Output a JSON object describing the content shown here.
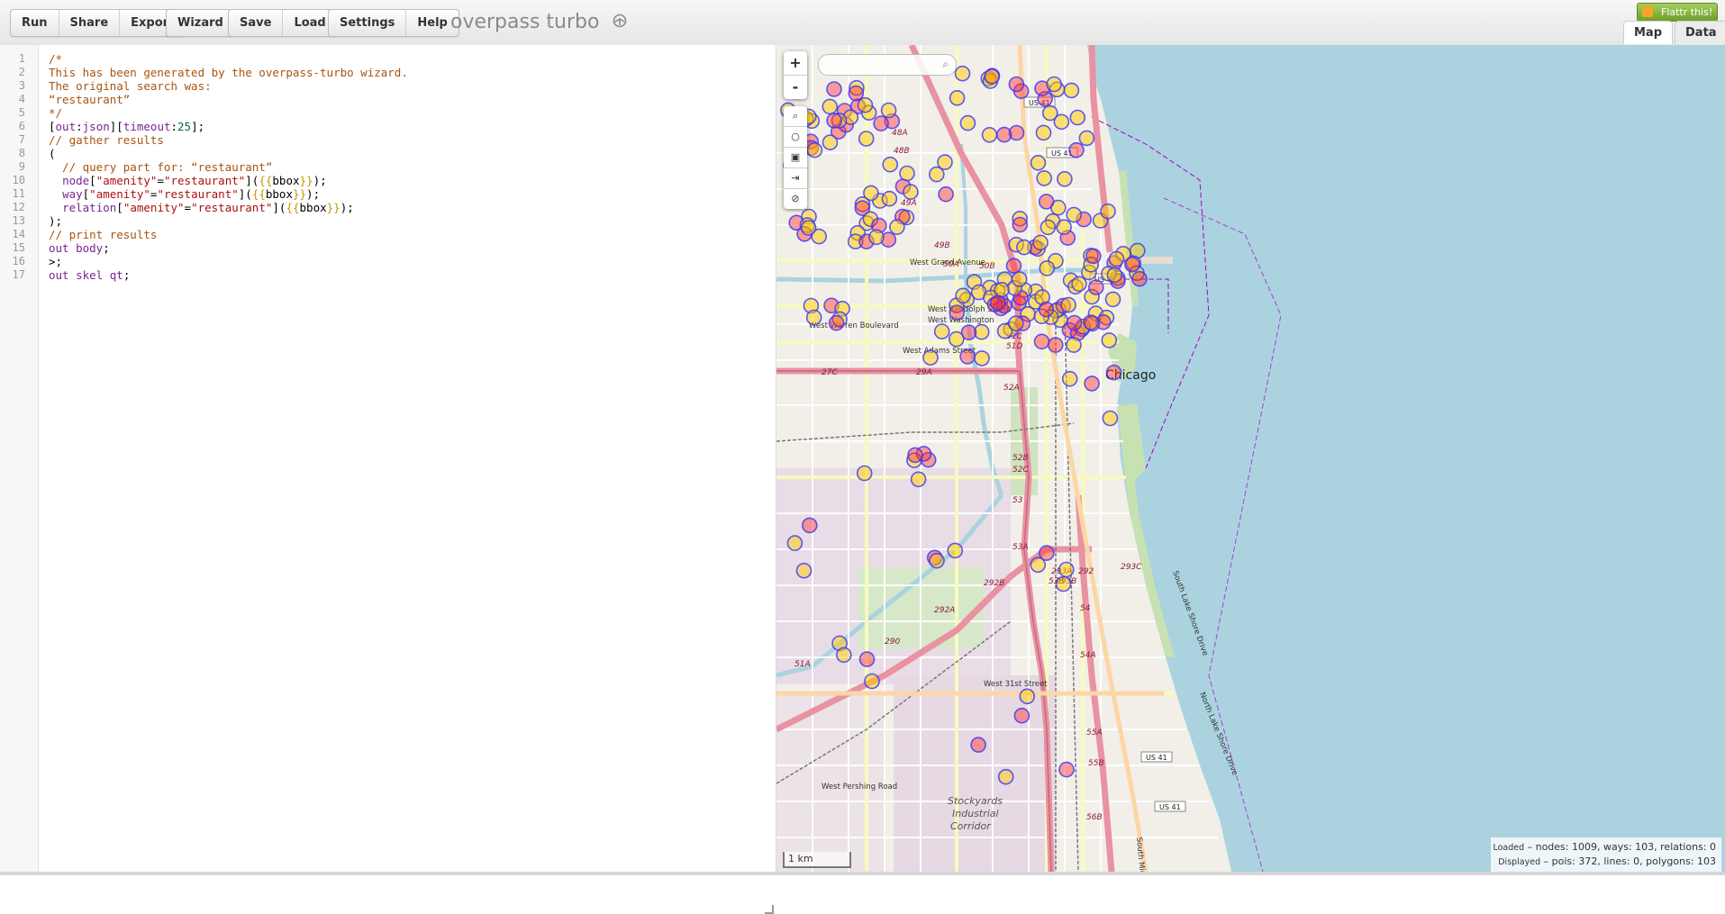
{
  "toolbar": {
    "groups": [
      [
        "Run",
        "Share",
        "Export"
      ],
      [
        "Wizard"
      ],
      [
        "Save",
        "Load"
      ],
      [
        "Settings",
        "Help"
      ]
    ],
    "app_title": "overpass turbo",
    "flattr_label": "Flattr this!",
    "view_tabs": [
      {
        "label": "Map",
        "active": true
      },
      {
        "label": "Data",
        "active": false
      }
    ]
  },
  "editor": {
    "line_numbers": [
      "1",
      "2",
      "3",
      "4",
      "5",
      "6",
      "7",
      "8",
      "9",
      "10",
      "11",
      "12",
      "13",
      "14",
      "15",
      "16",
      "17"
    ],
    "lines": [
      [
        {
          "t": "/*",
          "c": "cm"
        }
      ],
      [
        {
          "t": "This has been generated by the overpass-turbo wizard.",
          "c": "cm"
        }
      ],
      [
        {
          "t": "The original search was:",
          "c": "cm"
        }
      ],
      [
        {
          "t": "“restaurant”",
          "c": "cm"
        }
      ],
      [
        {
          "t": "*/",
          "c": "cm"
        }
      ],
      [
        {
          "t": "[",
          "c": "pl"
        },
        {
          "t": "out",
          "c": "kw"
        },
        {
          "t": ":",
          "c": "pl"
        },
        {
          "t": "json",
          "c": "kw"
        },
        {
          "t": "][",
          "c": "pl"
        },
        {
          "t": "timeout",
          "c": "kw"
        },
        {
          "t": ":",
          "c": "pl"
        },
        {
          "t": "25",
          "c": "num"
        },
        {
          "t": "];",
          "c": "pl"
        }
      ],
      [
        {
          "t": "// gather results",
          "c": "cm"
        }
      ],
      [
        {
          "t": "(",
          "c": "pl"
        }
      ],
      [
        {
          "t": "  // query part for: “restaurant”",
          "c": "cm"
        }
      ],
      [
        {
          "t": "  ",
          "c": "pl"
        },
        {
          "t": "node",
          "c": "kw"
        },
        {
          "t": "[",
          "c": "pl"
        },
        {
          "t": "\"amenity\"",
          "c": "str"
        },
        {
          "t": "=",
          "c": "pl"
        },
        {
          "t": "\"restaurant\"",
          "c": "str"
        },
        {
          "t": "](",
          "c": "pl"
        },
        {
          "t": "{{",
          "c": "br"
        },
        {
          "t": "bbox",
          "c": "pl"
        },
        {
          "t": "}}",
          "c": "br"
        },
        {
          "t": ");",
          "c": "pl"
        }
      ],
      [
        {
          "t": "  ",
          "c": "pl"
        },
        {
          "t": "way",
          "c": "kw"
        },
        {
          "t": "[",
          "c": "pl"
        },
        {
          "t": "\"amenity\"",
          "c": "str"
        },
        {
          "t": "=",
          "c": "pl"
        },
        {
          "t": "\"restaurant\"",
          "c": "str"
        },
        {
          "t": "](",
          "c": "pl"
        },
        {
          "t": "{{",
          "c": "br"
        },
        {
          "t": "bbox",
          "c": "pl"
        },
        {
          "t": "}}",
          "c": "br"
        },
        {
          "t": ");",
          "c": "pl"
        }
      ],
      [
        {
          "t": "  ",
          "c": "pl"
        },
        {
          "t": "relation",
          "c": "kw"
        },
        {
          "t": "[",
          "c": "pl"
        },
        {
          "t": "\"amenity\"",
          "c": "str"
        },
        {
          "t": "=",
          "c": "pl"
        },
        {
          "t": "\"restaurant\"",
          "c": "str"
        },
        {
          "t": "](",
          "c": "pl"
        },
        {
          "t": "{{",
          "c": "br"
        },
        {
          "t": "bbox",
          "c": "pl"
        },
        {
          "t": "}}",
          "c": "br"
        },
        {
          "t": ");",
          "c": "pl"
        }
      ],
      [
        {
          "t": ");",
          "c": "pl"
        }
      ],
      [
        {
          "t": "// print results",
          "c": "cm"
        }
      ],
      [
        {
          "t": "out",
          "c": "kw"
        },
        {
          "t": " ",
          "c": "pl"
        },
        {
          "t": "body",
          "c": "kw"
        },
        {
          "t": ";",
          "c": "pl"
        }
      ],
      [
        {
          "t": ">;",
          "c": "pl"
        }
      ],
      [
        {
          "t": "out",
          "c": "kw"
        },
        {
          "t": " ",
          "c": "pl"
        },
        {
          "t": "skel",
          "c": "kw"
        },
        {
          "t": " ",
          "c": "pl"
        },
        {
          "t": "qt",
          "c": "kw"
        },
        {
          "t": ";",
          "c": "pl"
        }
      ]
    ]
  },
  "map": {
    "zoom_in": "+",
    "zoom_out": "-",
    "scale_label": "1 km",
    "city_label": "Chicago",
    "highway_shields": [
      "US 41",
      "US 41",
      "US 41",
      "US 41",
      "US 41"
    ],
    "street_labels": [
      "West Grand Avenue",
      "West Randolph Street",
      "West Washington",
      "West Warren Boulevard",
      "West Adams Street",
      "West 31st Street",
      "West Pershing Road",
      "South Lake Shore Drive",
      "South Michigan Avenue",
      "North Lake Shore Drive"
    ],
    "area_label_lines": [
      "Stockyards",
      "Industrial",
      "Corridor"
    ],
    "exit_labels": [
      "48A",
      "48B",
      "49A",
      "49B",
      "50A",
      "50B",
      "51B",
      "51C",
      "51D",
      "52A",
      "52B",
      "52C",
      "53",
      "53A",
      "53B",
      "54",
      "54A",
      "55A",
      "55B",
      "56B",
      "27C",
      "29A",
      "290",
      "292A",
      "292B",
      "293A",
      "293B",
      "293C",
      "292",
      "51A"
    ],
    "colors": {
      "water": "#aad3df",
      "land": "#f2efe9",
      "marker_stroke": "#3333ff",
      "poi_fill": "#ffcc00",
      "polygon_fill": "#ff3333"
    }
  },
  "stats": {
    "loaded_label": "Loaded",
    "loaded_text": "– nodes: 1009, ways: 103, relations: 0",
    "displayed_label": "Displayed",
    "displayed_text": "– pois: 372, lines: 0, polygons: 103"
  }
}
